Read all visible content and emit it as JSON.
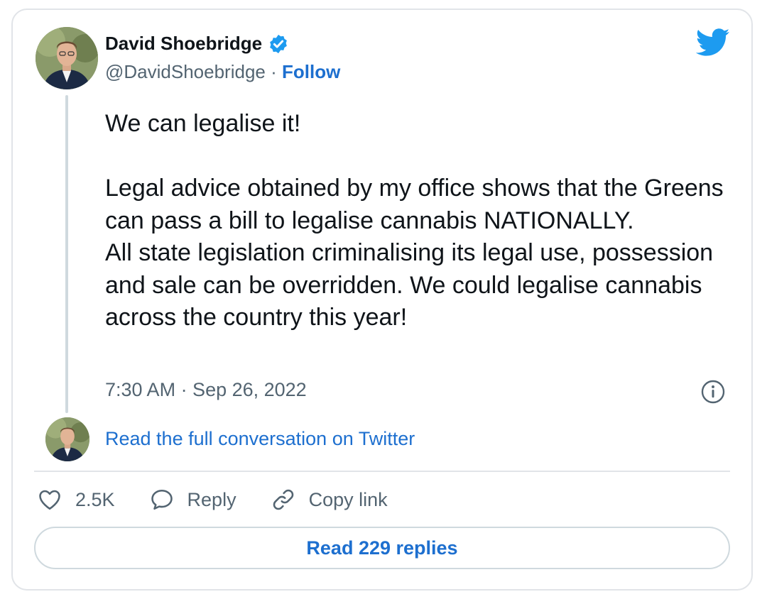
{
  "author": {
    "name": "David Shoebridge",
    "handle": "@DavidShoebridge",
    "separator": "·",
    "follow_label": "Follow"
  },
  "tweet": {
    "text": "We can legalise it!\n\nLegal advice obtained by my office shows that the Greens can pass a bill to legalise cannabis NATIONALLY.\nAll state legislation criminalising its legal use, possession and sale can be overridden. We could legalise cannabis across the country this year!",
    "timestamp": "7:30 AM · Sep 26, 2022"
  },
  "conversation": {
    "link_label": "Read the full conversation on Twitter"
  },
  "actions": {
    "like_count": "2.5K",
    "reply_label": "Reply",
    "copy_label": "Copy link"
  },
  "replies_button": {
    "label": "Read 229 replies"
  },
  "icons": {
    "verified": "verified-badge-icon",
    "brand": "twitter-bird-icon",
    "info": "info-icon",
    "like": "heart-icon",
    "reply": "speech-bubble-icon",
    "copy": "link-icon"
  },
  "colors": {
    "link": "#1d6fcf",
    "twitter_blue": "#1d9bf0",
    "text": "#0f1419",
    "muted": "#536471"
  }
}
